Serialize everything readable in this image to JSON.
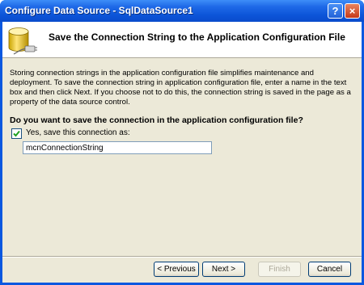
{
  "window": {
    "title": "Configure Data Source - SqlDataSource1",
    "help_label": "?",
    "close_label": "×"
  },
  "header": {
    "title": "Save the Connection String to the Application Configuration File"
  },
  "body": {
    "description": "Storing connection strings in the application configuration file simplifies maintenance and deployment. To save the connection string in application configuration file, enter a name in the text box and then click Next. If you choose not to do this, the connection string is saved in the page as a property of the data source control.",
    "question": "Do you want to save the connection in the application configuration file?",
    "checkbox_label": "Yes, save this connection as:",
    "checkbox_checked": true,
    "connection_name": "mcnConnectionString"
  },
  "buttons": {
    "previous": "< Previous",
    "next": "Next >",
    "finish": "Finish",
    "cancel": "Cancel"
  },
  "colors": {
    "titlebar": "#0a54d8",
    "dialog_bg": "#ece9d8",
    "checkmark": "#21a121"
  }
}
